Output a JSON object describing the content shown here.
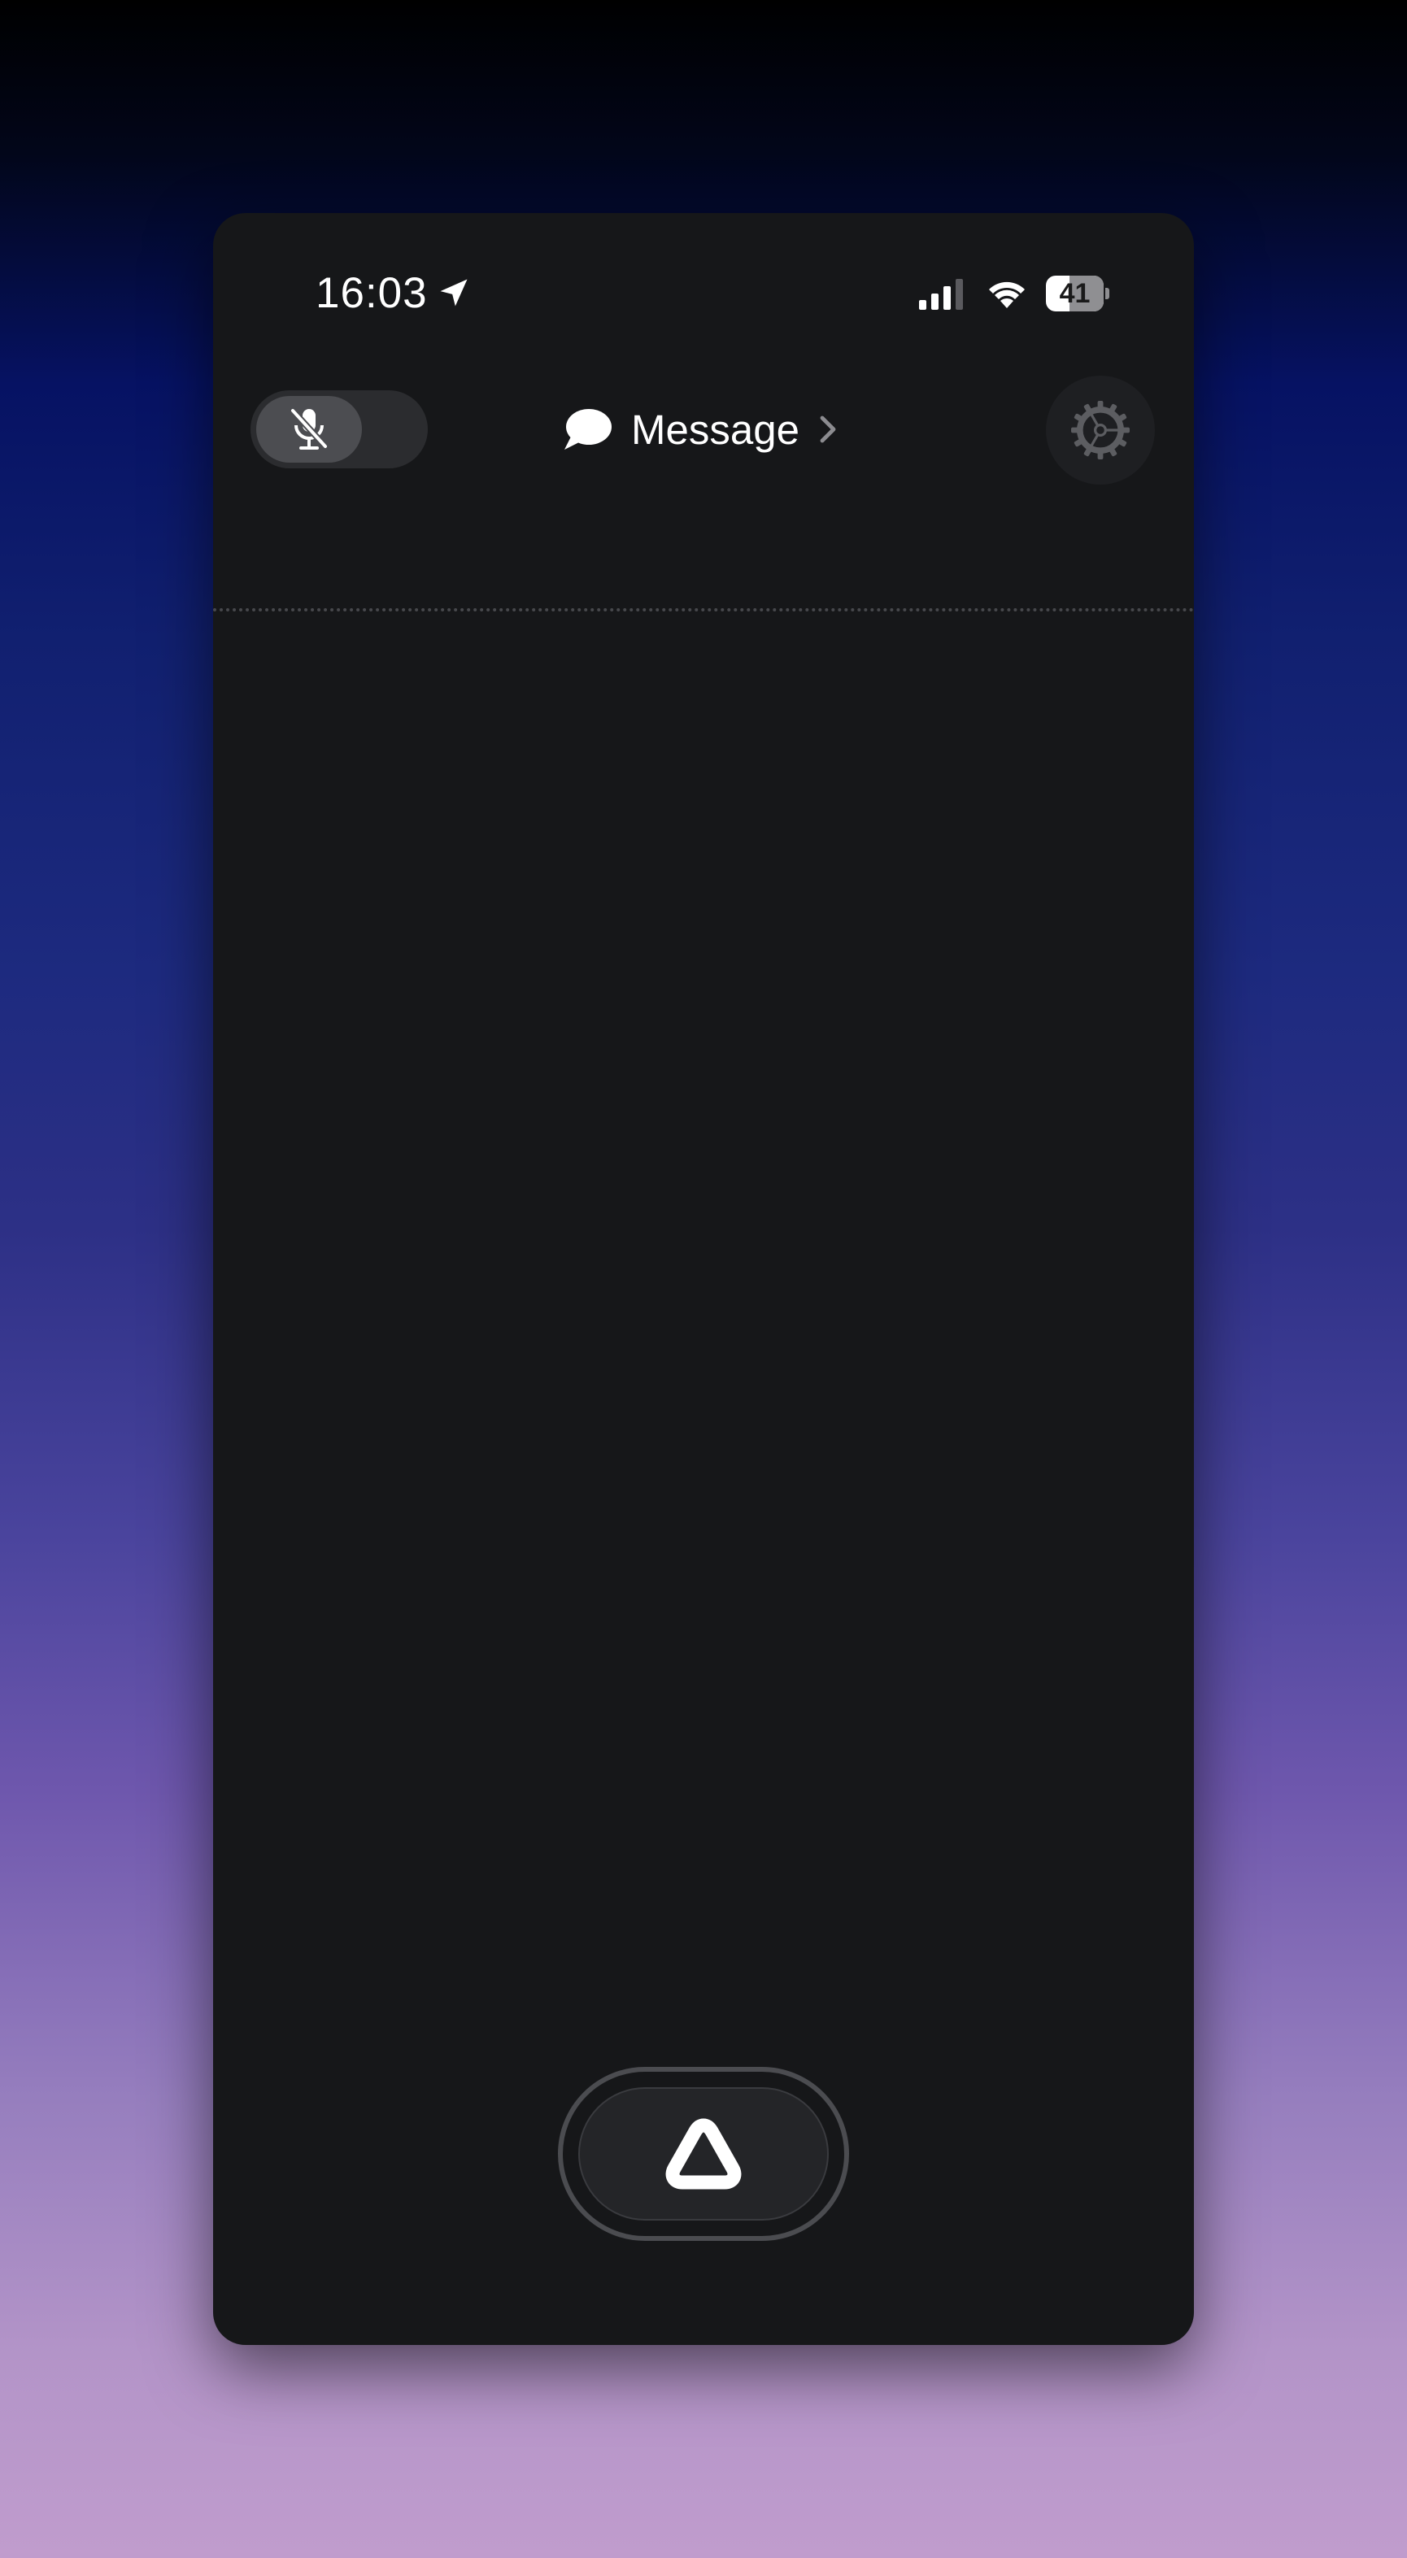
{
  "status_bar": {
    "time": "16:03",
    "battery_level": "41",
    "battery_fraction": 0.41,
    "location_icon": "location-arrow-icon",
    "signal_icon": "cellular-signal-icon",
    "wifi_icon": "wifi-icon"
  },
  "header": {
    "mute_toggle": {
      "icon": "mic-off-icon",
      "state": "muted"
    },
    "message_label": "Message",
    "message_icon": "speech-bubble-icon",
    "chevron_icon": "chevron-right-icon",
    "settings_icon": "gear-icon"
  },
  "main_action": {
    "icon": "rounded-triangle-icon"
  },
  "colors": {
    "panel_background": "#161719",
    "accent_text": "#ffffff",
    "muted_icon": "#6b6c70"
  }
}
